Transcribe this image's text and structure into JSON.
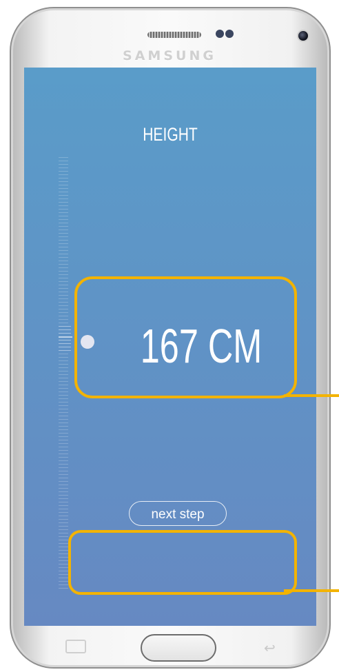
{
  "device": {
    "brand": "SAMSUNG"
  },
  "screen": {
    "title": "HEIGHT",
    "height_value": 167,
    "height_unit": "CM",
    "height_display": "167 CM",
    "next_button_label": "next step",
    "background_top": "#5a9cc9",
    "background_bottom": "#6689c2"
  },
  "annotations": {
    "highlight_color": "#f3b300"
  },
  "icons": {
    "recent_apps": "recent-apps-icon",
    "back": "back-icon",
    "home": "home-button"
  }
}
